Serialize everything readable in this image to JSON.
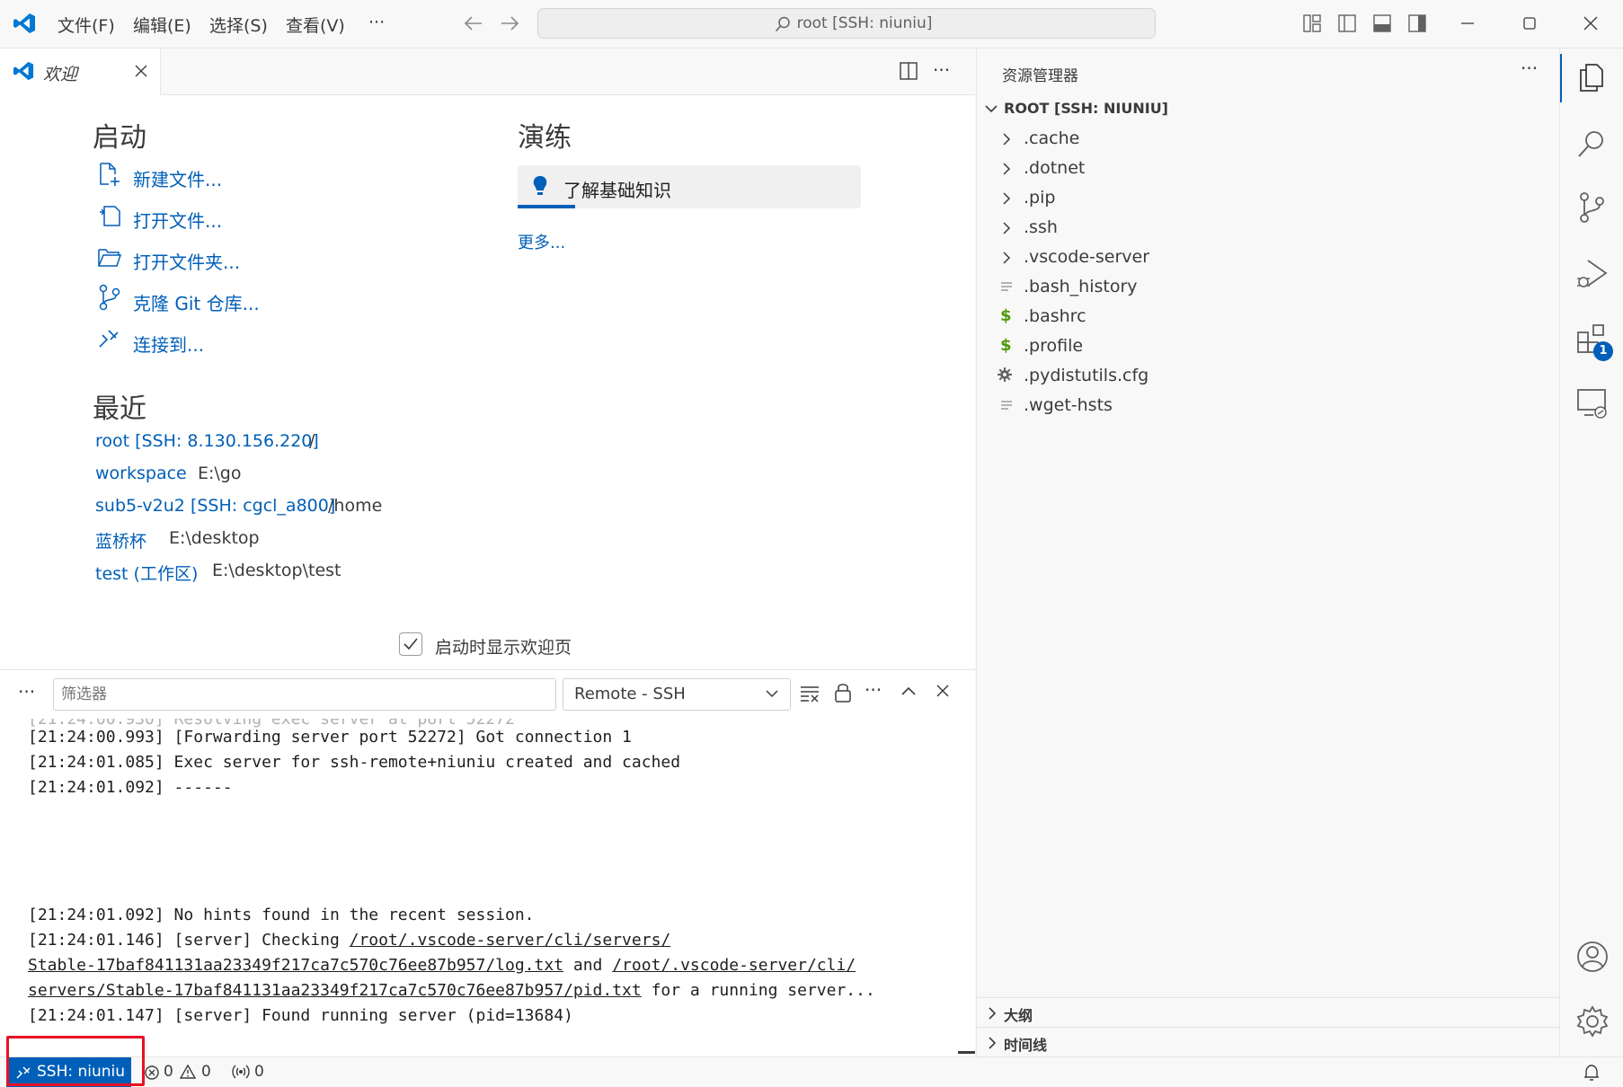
{
  "titlebar": {
    "menus": [
      "文件(F)",
      "编辑(E)",
      "选择(S)",
      "查看(V)",
      "···"
    ],
    "search_text": "root [SSH: niuniu]"
  },
  "tabs": [
    {
      "label": "欢迎"
    }
  ],
  "welcome": {
    "start_title": "启动",
    "start_items": [
      "新建文件...",
      "打开文件...",
      "打开文件夹...",
      "克隆 Git 仓库...",
      "连接到..."
    ],
    "walkthrough_title": "演练",
    "walkthrough_item": "了解基础知识",
    "more_label": "更多...",
    "recent_title": "最近",
    "recent": [
      {
        "name": "root [SSH: 8.130.156.220]",
        "path": "/"
      },
      {
        "name": "workspace",
        "path": "E:\\go"
      },
      {
        "name": "sub5-v2u2 [SSH: cgcl_a800]",
        "path": "/home"
      },
      {
        "name": "蓝桥杯",
        "path": "E:\\desktop"
      },
      {
        "name": "test (工作区)",
        "path": "E:\\desktop\\test"
      }
    ],
    "show_on_startup": "启动时显示欢迎页"
  },
  "panel": {
    "filter_placeholder": "筛选器",
    "channel": "Remote - SSH",
    "log": {
      "l1": "[21:24:00.993] [Forwarding server port 52272] Got connection 1",
      "l2": "[21:24:01.085] Exec server for ssh-remote+niuniu created and cached",
      "l3": "[21:24:01.092] ------",
      "l4": "[21:24:01.092] No hints found in the recent session.",
      "l5a": "[21:24:01.146] [server] Checking ",
      "l5b": "/root/.vscode-server/cli/servers/",
      "l6a": "Stable-17baf841131aa23349f217ca7c570c76ee87b957/log.txt",
      "l6b": " and ",
      "l6c": "/root/.vscode-server/cli/",
      "l7a": "servers/Stable-17baf841131aa23349f217ca7c570c76ee87b957/pid.txt",
      "l7b": " for a running server...",
      "l8": "[21:24:01.147] [server] Found running server (pid=13684)"
    }
  },
  "sidebar": {
    "title": "资源管理器",
    "root": "ROOT [SSH: NIUNIU]",
    "items": [
      {
        "name": ".cache",
        "type": "folder"
      },
      {
        "name": ".dotnet",
        "type": "folder"
      },
      {
        "name": ".pip",
        "type": "folder"
      },
      {
        "name": ".ssh",
        "type": "folder"
      },
      {
        "name": ".vscode-server",
        "type": "folder"
      },
      {
        "name": ".bash_history",
        "type": "text"
      },
      {
        "name": ".bashrc",
        "type": "shell"
      },
      {
        "name": ".profile",
        "type": "shell"
      },
      {
        "name": ".pydistutils.cfg",
        "type": "config"
      },
      {
        "name": ".wget-hsts",
        "type": "text"
      }
    ],
    "outline": "大纲",
    "timeline": "时间线"
  },
  "activity": {
    "extensions_badge": "1"
  },
  "statusbar": {
    "remote": "SSH: niuniu",
    "errors": "0",
    "warnings": "0",
    "ports": "0"
  },
  "colors": {
    "accent": "#005fb8",
    "highlight_box": "#e81123",
    "shell_icon": "#4d9a06"
  }
}
